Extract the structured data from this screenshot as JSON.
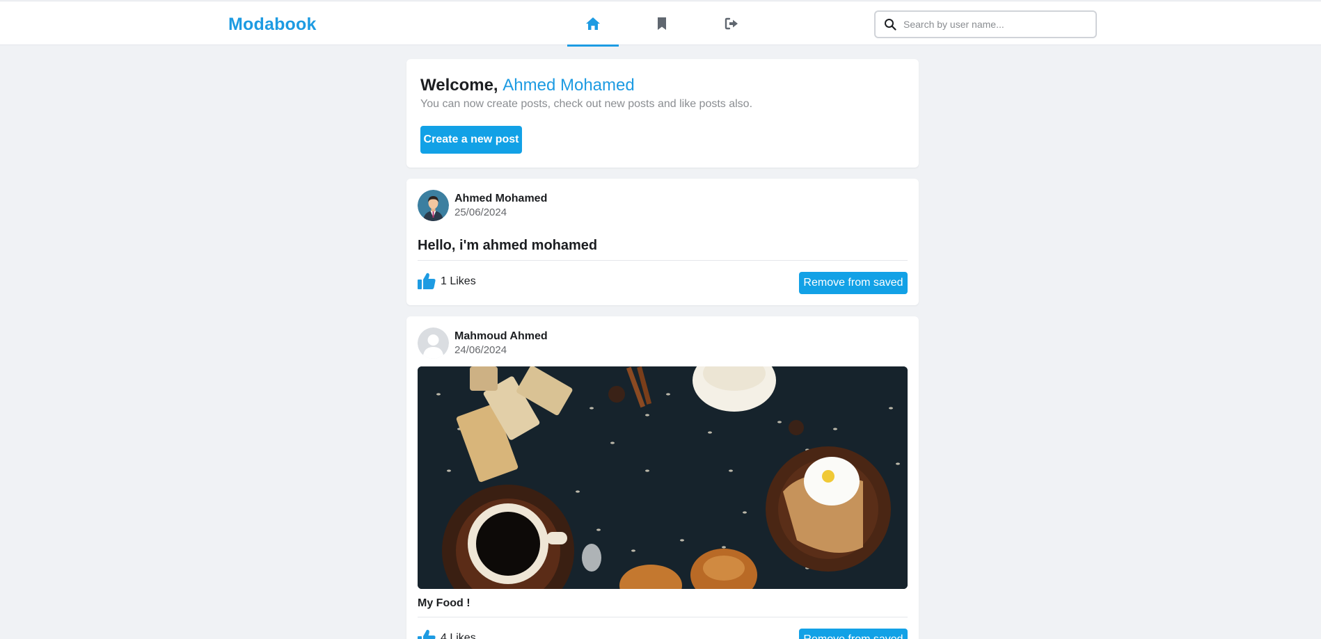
{
  "app": {
    "name": "Modabook"
  },
  "nav": {
    "tabs": [
      {
        "name": "home",
        "icon": "home-icon",
        "active": true
      },
      {
        "name": "saved",
        "icon": "bookmark-icon",
        "active": false
      },
      {
        "name": "logout",
        "icon": "logout-icon",
        "active": false
      }
    ]
  },
  "search": {
    "placeholder": "Search by user name..."
  },
  "welcome": {
    "greeting": "Welcome,",
    "user_name": "Ahmed Mohamed",
    "subtitle": "You can now create posts, check out new posts and like posts also.",
    "create_label": "Create a new post"
  },
  "posts": [
    {
      "author": "Ahmed Mohamed",
      "date": "25/06/2024",
      "text": "Hello, i'm ahmed mohamed",
      "likes": "1 Likes",
      "action_label": "Remove from saved",
      "avatar": "man-avatar"
    },
    {
      "author": "Mahmoud Ahmed",
      "date": "24/06/2024",
      "text": "My Food !",
      "likes": "4 Likes",
      "action_label": "Remove from saved",
      "avatar": "default-avatar",
      "image": "food-photo"
    }
  ],
  "colors": {
    "accent": "#1d9be2",
    "button": "#12a1e6",
    "background": "#f0f2f5"
  }
}
